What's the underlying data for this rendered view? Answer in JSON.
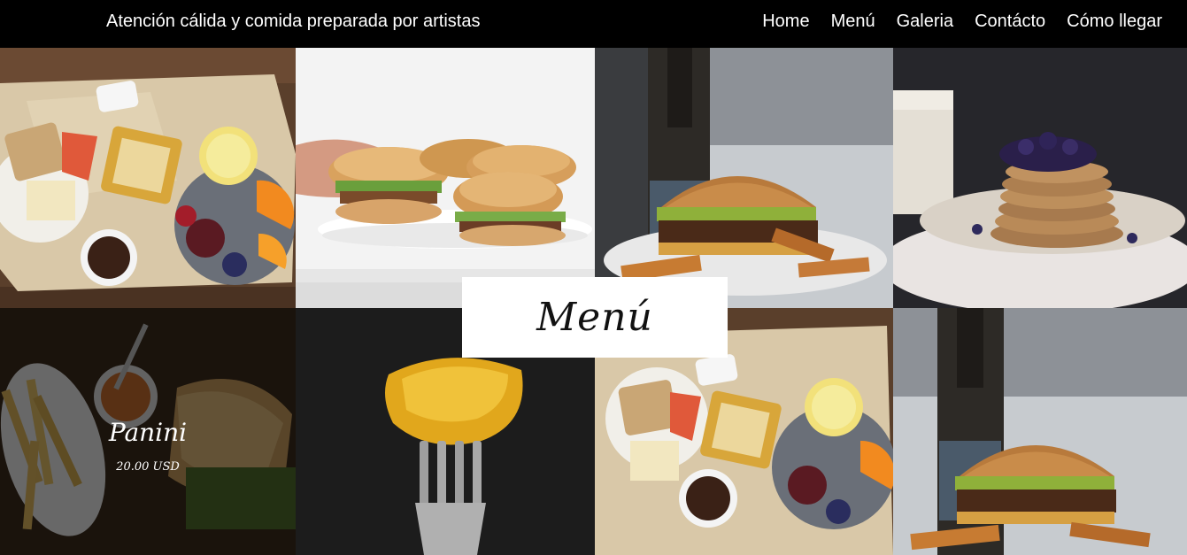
{
  "header": {
    "tagline": "Atención cálida y comida preparada por artistas",
    "nav": [
      "Home",
      "Menú",
      "Galeria",
      "Contácto",
      "Cómo llegar"
    ]
  },
  "section": {
    "title": "Menú"
  },
  "menu_items": [
    {
      "name": "Panini",
      "price": "20.00 USD"
    }
  ],
  "colors": {
    "header_bg": "#000000",
    "text_light": "#ffffff",
    "heading_box_bg": "#ffffff"
  }
}
